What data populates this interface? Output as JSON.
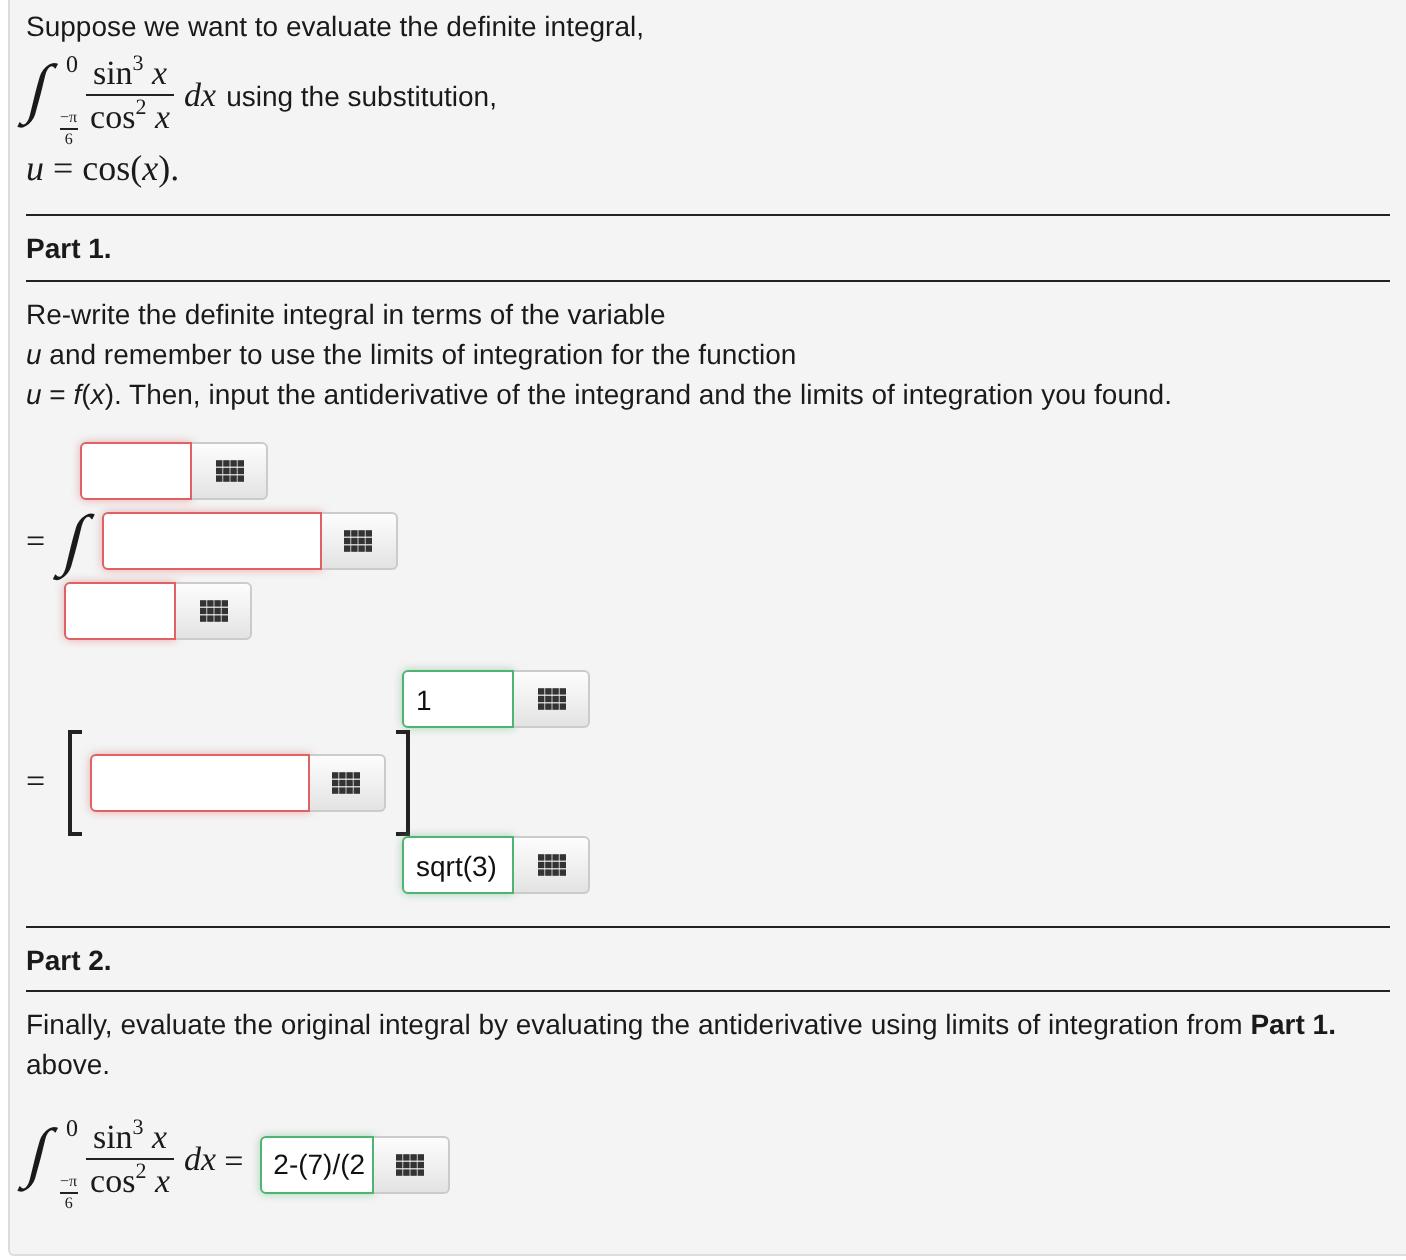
{
  "intro": {
    "text": "Suppose we want to evaluate the definite integral,",
    "integral": {
      "sign": "∫",
      "upper_limit": "0",
      "lower_limit": {
        "numerator": "−π",
        "denominator": "6"
      },
      "numerator": "sin$^{3}$ *x*",
      "denominator": "cos$^{2}$ *x*",
      "differential": "dx"
    },
    "trailing": "using the substitution,",
    "substitution": "*u* = cos(*x*)."
  },
  "part1": {
    "title": "Part 1.",
    "instructions": "Re-write the definite integral in terms of the variable\n*u* and remember to use the limits of integration for the function\n*u* = *f*(*x*). Then, input the antiderivative of the integrand and the limits of integration you found.",
    "integral_row": {
      "equals": "=",
      "sign": "∫",
      "upper_limit": {
        "correct": false
      },
      "integrand": {
        "correct": false
      },
      "lower_limit": {
        "correct": false
      }
    },
    "evaluation_row": {
      "equals": "=",
      "antiderivative": {
        "correct": false
      },
      "upper_limit": {
        "value": "1",
        "correct": true
      },
      "lower_limit": {
        "value": "sqrt(3)",
        "correct": true
      }
    }
  },
  "part2": {
    "title": "Part 2.",
    "instructions": "Finally, evaluate the original integral by evaluating the antiderivative using limits of integration from **Part 1.** above.",
    "integral": {
      "sign": "∫",
      "upper_limit": "0",
      "lower_limit": {
        "numerator": "−π",
        "denominator": "6"
      },
      "numerator": "sin$^{3}$ *x*",
      "denominator": "cos$^{2}$ *x*",
      "differential": "dx"
    },
    "equals": "=",
    "answer": {
      "value": "2-(7)/(2",
      "correct": true
    }
  }
}
